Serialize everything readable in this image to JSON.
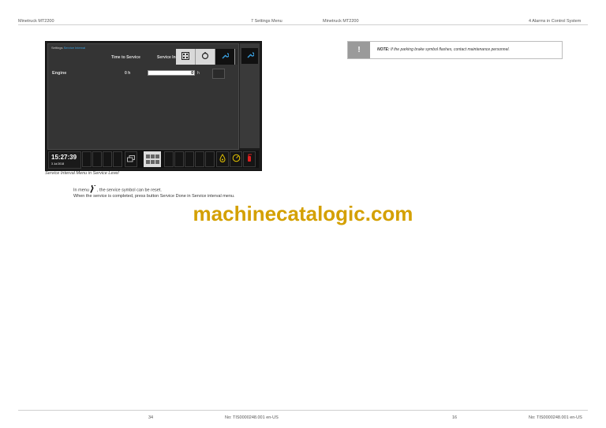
{
  "header": {
    "left_product": "Minetruck MT2200",
    "left_section": "7 Settings Menu",
    "right_product": "Minetruck MT2200",
    "right_section": "4 Alarms in Control System"
  },
  "screen": {
    "breadcrumb_main": "Settings",
    "breadcrumb_sub": "Service Interval",
    "col_time_to_service": "Time to Service",
    "col_service_interval": "Service In",
    "row_label": "Engine",
    "row_value": "0 h",
    "input_value": "0",
    "input_unit": "h",
    "clock_time": "15:27:39",
    "clock_date": "3 Jul 2018",
    "tabs": [
      "calculator-icon",
      "gear-ring-icon",
      "wrench-icon"
    ],
    "side_tab_icon": "wrench-icon"
  },
  "caption": "Service Interval Menu in Service Level",
  "body": {
    "line1_prefix": "In menu",
    "line1_suffix": ", the service symbol can be reset.",
    "line2": "When the service is completed, press button Service Done in Service interval menu."
  },
  "watermark": "machinecatalogic.com",
  "note": {
    "icon": "!",
    "label": "NOTE:",
    "text": " If the parking brake symbol flashes, contact maintenance personnel."
  },
  "footer": {
    "left_page": "34",
    "left_doc": "No: TIS0000248.001 en-US",
    "right_page": "16",
    "right_doc": "No: TIS0000248.001 en-US"
  },
  "colors": {
    "accent_blue": "#3aa0e0",
    "watermark": "#d4a000",
    "alarm_red": "#e02020",
    "warning_yellow": "#e6c400"
  }
}
